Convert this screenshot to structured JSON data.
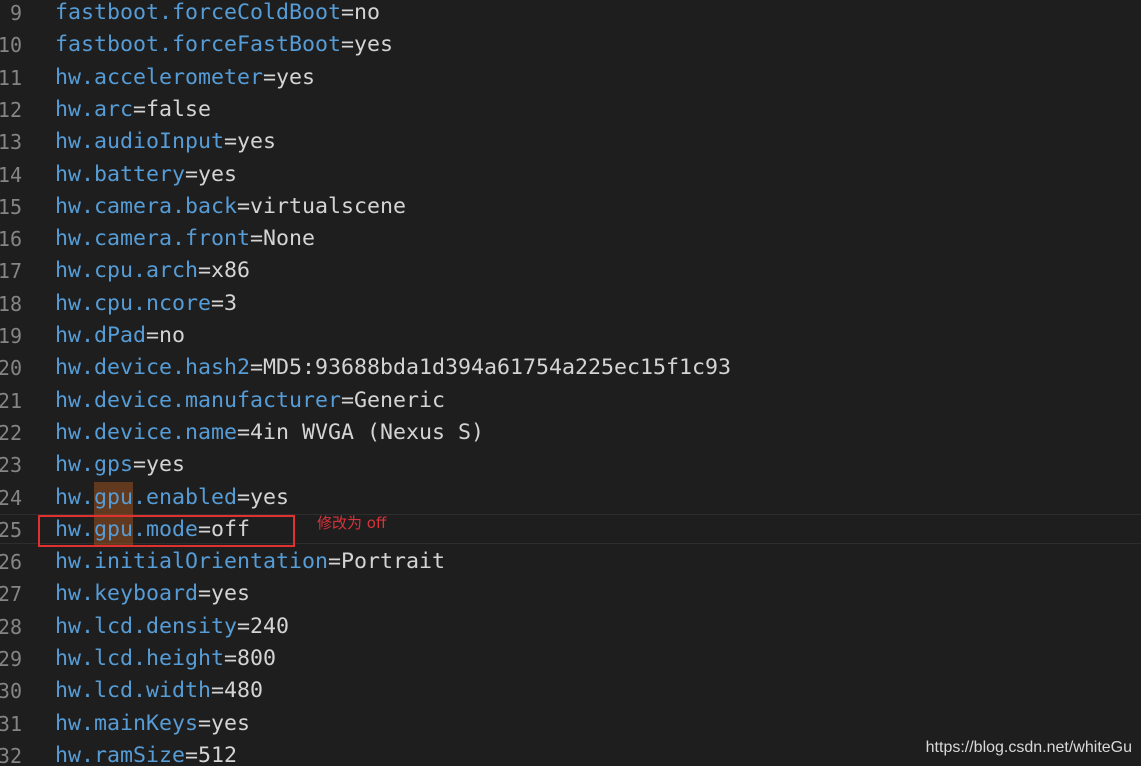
{
  "lines": [
    {
      "number": "9",
      "key": "fastboot.forceColdBoot",
      "value": "no"
    },
    {
      "number": "10",
      "key": "fastboot.forceFastBoot",
      "value": "yes"
    },
    {
      "number": "11",
      "key": "hw.accelerometer",
      "value": "yes"
    },
    {
      "number": "12",
      "key": "hw.arc",
      "value": "false"
    },
    {
      "number": "13",
      "key": "hw.audioInput",
      "value": "yes"
    },
    {
      "number": "14",
      "key": "hw.battery",
      "value": "yes"
    },
    {
      "number": "15",
      "key": "hw.camera.back",
      "value": "virtualscene"
    },
    {
      "number": "16",
      "key": "hw.camera.front",
      "value": "None"
    },
    {
      "number": "17",
      "key": "hw.cpu.arch",
      "value": "x86"
    },
    {
      "number": "18",
      "key": "hw.cpu.ncore",
      "value": "3"
    },
    {
      "number": "19",
      "key": "hw.dPad",
      "value": "no"
    },
    {
      "number": "20",
      "key": "hw.device.hash2",
      "value": "MD5:93688bda1d394a61754a225ec15f1c93"
    },
    {
      "number": "21",
      "key": "hw.device.manufacturer",
      "value": "Generic"
    },
    {
      "number": "22",
      "key": "hw.device.name",
      "value": "4in WVGA (Nexus S)"
    },
    {
      "number": "23",
      "key": "hw.gps",
      "value": "yes"
    },
    {
      "number": "24",
      "key": "hw.gpu.enabled",
      "value": "yes"
    },
    {
      "number": "25",
      "key": "hw.gpu.mode",
      "value": "off"
    },
    {
      "number": "26",
      "key": "hw.initialOrientation",
      "value": "Portrait"
    },
    {
      "number": "27",
      "key": "hw.keyboard",
      "value": "yes"
    },
    {
      "number": "28",
      "key": "hw.lcd.density",
      "value": "240"
    },
    {
      "number": "29",
      "key": "hw.lcd.height",
      "value": "800"
    },
    {
      "number": "30",
      "key": "hw.lcd.width",
      "value": "480"
    },
    {
      "number": "31",
      "key": "hw.mainKeys",
      "value": "yes"
    },
    {
      "number": "32",
      "key": "hw.ramSize",
      "value": "512"
    }
  ],
  "separator": "=",
  "annotation": {
    "note": "修改为 off",
    "highlight_color": "#e03131"
  },
  "watermark": "https://blog.csdn.net/whiteGu",
  "colors": {
    "background": "#1e1e1e",
    "key": "#569cd6",
    "value": "#d4d4d4",
    "line_number": "#858585",
    "search_highlight": "#8a4a1c"
  }
}
